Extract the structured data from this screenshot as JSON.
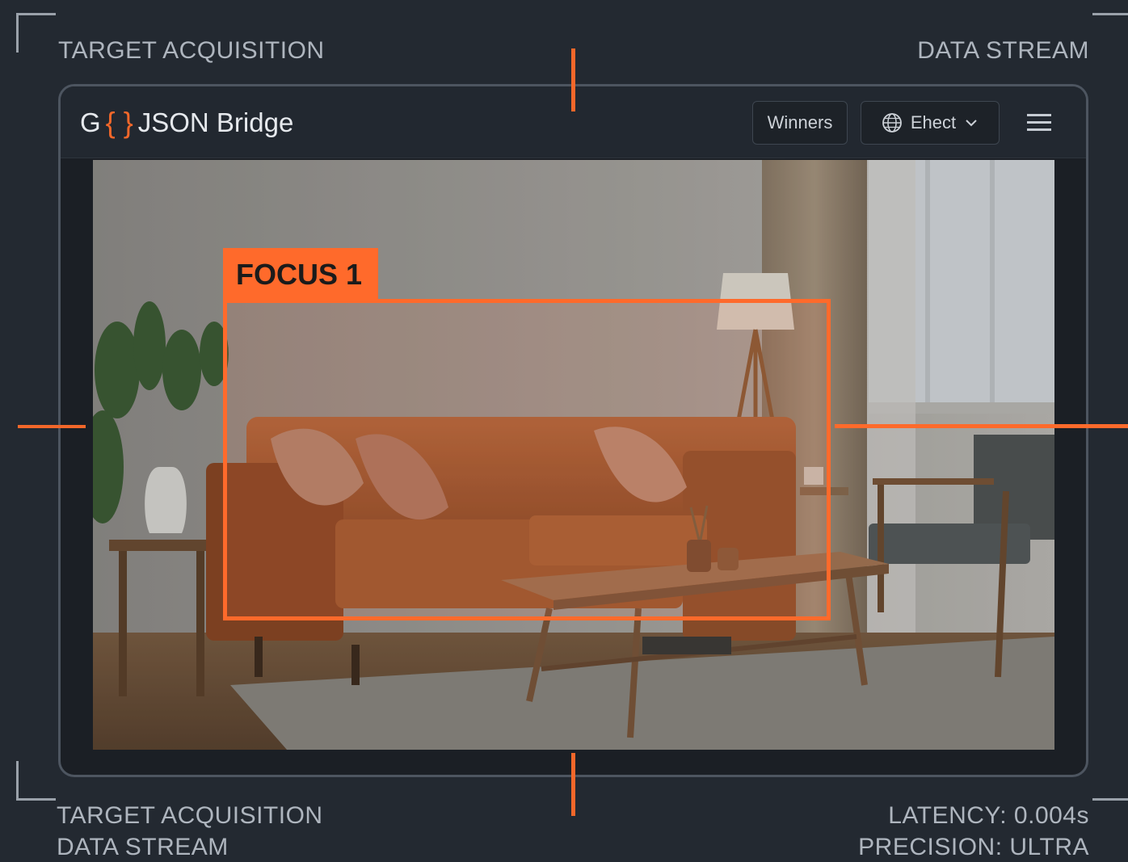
{
  "hud": {
    "top_left": "TARGET ACQUISITION",
    "top_right": "DATA STREAM",
    "bottom_left_line1": "TARGET ACQUISITION",
    "bottom_left_line2": "DATA STREAM",
    "latency": "LATENCY: 0.004s",
    "precision": "PRECISION: ULTRA"
  },
  "app": {
    "brand_prefix": "G",
    "brand_braces": "{ }",
    "brand_name": "JSON Bridge",
    "winners_label": "Winners",
    "select_label": "Ehect",
    "globe_icon": "globe-icon",
    "chevron_icon": "chevron-down-icon",
    "menu_icon": "hamburger-menu-icon"
  },
  "detection": {
    "focus_label": "FOCUS 1"
  },
  "colors": {
    "accent": "#ff6a2b",
    "background": "#232931",
    "panel": "#222830"
  }
}
